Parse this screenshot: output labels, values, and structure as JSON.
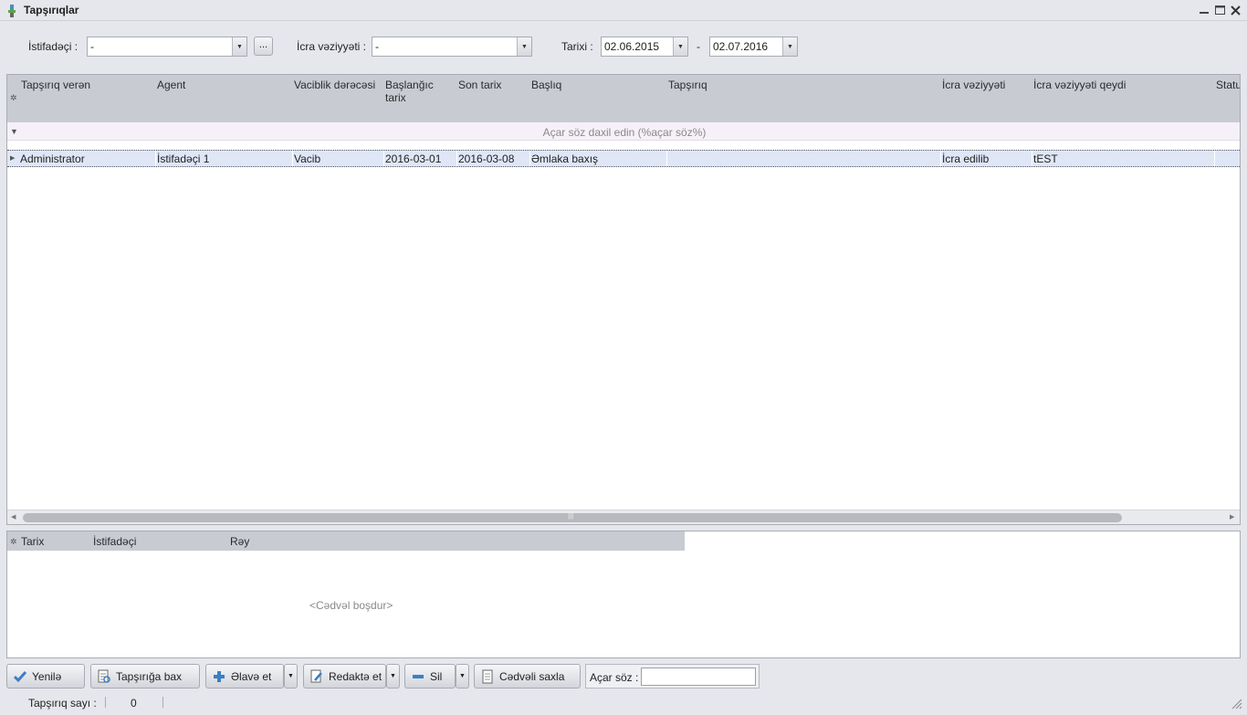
{
  "window": {
    "title": "Tapşırıqlar",
    "controls": {
      "minimize": "▁",
      "maximize": "□",
      "close": "✕"
    }
  },
  "filters": {
    "user_label": "İstifadəçi :",
    "user_value": "-",
    "browse_label": "...",
    "status_label": "İcra vəziyyəti :",
    "status_value": "-",
    "date_label": "Tarixi :",
    "date_from": "02.06.2015",
    "date_separator": "-",
    "date_to": "02.07.2016"
  },
  "grid": {
    "columns": [
      "Tapşırıq verən",
      "Agent",
      "Vaciblik dərəcəsi",
      "Başlanğıc tarix",
      "Son tarix",
      "Başlıq",
      "Tapşırıq",
      "İcra vəziyyəti",
      "İcra vəziyyəti qeydi",
      "Statu"
    ],
    "auto_filter_placeholder": "Açar söz daxil edin (%açar söz%)",
    "rows": [
      {
        "giver": "Administrator",
        "agent": "İstifadəçi 1",
        "priority": "Vacib",
        "start_date": "2016-03-01",
        "end_date": "2016-03-08",
        "title": "Əmlaka baxış",
        "task": "",
        "exec_status": "İcra edilib",
        "exec_note": "tEST",
        "status": ""
      }
    ]
  },
  "detail_grid": {
    "columns": [
      "Tarix",
      "İstifadəçi",
      "Rəy"
    ],
    "empty_text": "<Cədvəl boşdur>"
  },
  "toolbar": {
    "refresh": "Yenilə",
    "view_task": "Tapşırığa bax",
    "add": "Əlavə et",
    "edit": "Redaktə et",
    "delete": "Sil",
    "save_table": "Cədvəli saxla",
    "search_label": "Açar söz :",
    "search_value": ""
  },
  "statusbar": {
    "count_label": "Tapşırıq sayı :",
    "count_value": "0"
  },
  "colors": {
    "header_bg": "#c9cbd3",
    "selected_row": "#dfe7f7",
    "window_bg": "#e6e7ec"
  }
}
